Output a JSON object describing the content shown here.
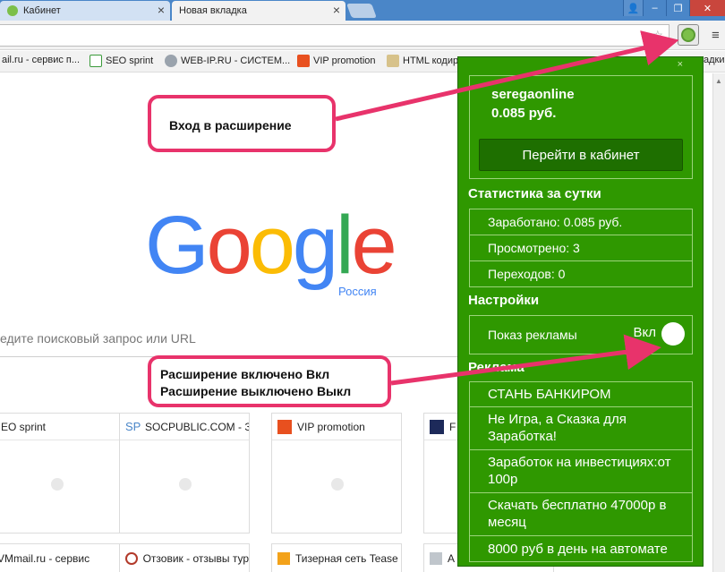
{
  "tabs": [
    {
      "label": "Кабинет",
      "close": "×"
    },
    {
      "label": "Новая вкладка",
      "close": "×"
    }
  ],
  "window_controls": {
    "profile": "👤",
    "minimize": "–",
    "maximize": "❐",
    "close": "✕"
  },
  "toolbar": {
    "star": "☆",
    "menu": "≡"
  },
  "bookmarks": [
    "ail.ru - сервис п...",
    "SEO sprint",
    "WEB-IP.RU - СИСТЕМ...",
    "VIP promotion",
    "HTML кодир",
    "адки"
  ],
  "google": {
    "letters": [
      "G",
      "o",
      "o",
      "g",
      "l",
      "e"
    ],
    "region": "Россия"
  },
  "search": {
    "placeholder": "едите поисковый запрос или URL"
  },
  "tiles": [
    {
      "label": "EO sprint"
    },
    {
      "label": "SOCPUBLIC.COM - З"
    },
    {
      "label": "VIP promotion"
    },
    {
      "label": "F"
    }
  ],
  "tiles_bottom": [
    {
      "label": "VMmail.ru - сервис"
    },
    {
      "label": "Отзовик - отзывы тур"
    },
    {
      "label": "Тизерная сеть Tease"
    },
    {
      "label": "А"
    }
  ],
  "annotations": {
    "login": "Вход в расширение",
    "toggle_on": "Расширение включено Вкл",
    "toggle_off": "Расширение выключено Выкл"
  },
  "popup": {
    "close": "×",
    "username": "seregaonline",
    "balance": "0.085 руб.",
    "cabinet_button": "Перейти в кабинет",
    "stats_title": "Статистика за сутки",
    "earned": "Заработано: 0.085 руб.",
    "viewed": "Просмотрено: 3",
    "clicks": "Переходов: 0",
    "settings_title": "Настройки",
    "show_ads": "Показ рекламы",
    "toggle_state": "Вкл",
    "ads_title": "Реклама",
    "ads": [
      "СТАНЬ БАНКИРОМ",
      "Не Игра, а Сказка для Заработка!",
      "Заработок на инвестициях:от 100р",
      "Скачать бесплатно 47000р в месяц",
      "8000 руб в день на автомате"
    ]
  },
  "colors": {
    "popup_bg": "#2f9800",
    "button_bg": "#1e6f00",
    "annotation": "#e8336b"
  }
}
